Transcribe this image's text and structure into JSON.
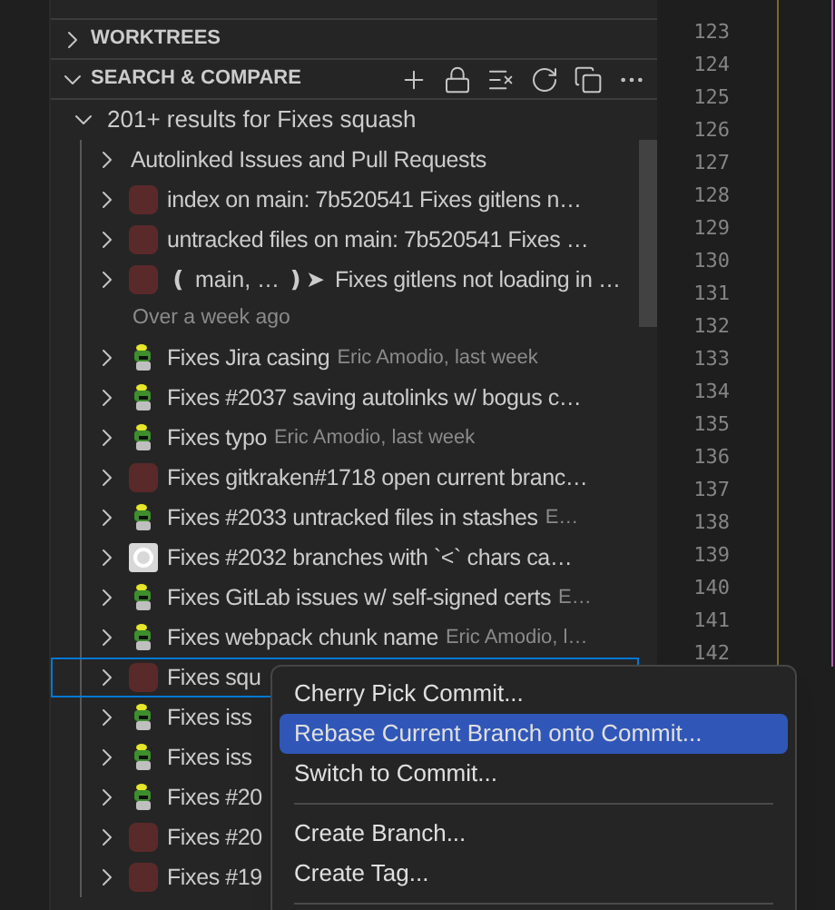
{
  "sections": [
    {
      "title": "WORKTREES",
      "expanded": false
    },
    {
      "title": "SEARCH & COMPARE",
      "expanded": true
    }
  ],
  "results": {
    "label": "201+ results for Fixes squash",
    "expanded": true,
    "rows": [
      {
        "kind": "group",
        "message": "Autolinked Issues and Pull Requests"
      },
      {
        "kind": "commit",
        "avatar": {
          "kind": "photo"
        },
        "message": "index on main: 7b520541 Fixes gitlens n…",
        "selected": false
      },
      {
        "kind": "commit",
        "avatar": {
          "kind": "photo"
        },
        "message": "untracked files on main: 7b520541 Fixes …",
        "selected": false
      },
      {
        "kind": "commit",
        "avatar": {
          "kind": "photo"
        },
        "badge": "❪ main, … ❫➤",
        "message": "Fixes gitlens not loading in …",
        "selected": false
      },
      {
        "kind": "separator",
        "message": "Over a week ago"
      },
      {
        "kind": "commit",
        "avatar": {
          "kind": "robot"
        },
        "message": "Fixes Jira casing",
        "author": "Eric Amodio, last week",
        "selected": false
      },
      {
        "kind": "commit",
        "avatar": {
          "kind": "robot"
        },
        "message": "Fixes #2037 saving autolinks w/ bogus c…",
        "selected": false
      },
      {
        "kind": "commit",
        "avatar": {
          "kind": "robot"
        },
        "message": "Fixes typo",
        "author": "Eric Amodio, last week",
        "selected": false
      },
      {
        "kind": "commit",
        "avatar": {
          "kind": "photo"
        },
        "message": "Fixes gitkraken#1718 open current branc…",
        "selected": false
      },
      {
        "kind": "commit",
        "avatar": {
          "kind": "robot"
        },
        "message": "Fixes #2033 untracked files in stashes",
        "author": "E…",
        "selected": false
      },
      {
        "kind": "commit",
        "avatar": {
          "kind": "github"
        },
        "message": "Fixes #2032 branches with `<` chars ca…",
        "selected": false
      },
      {
        "kind": "commit",
        "avatar": {
          "kind": "robot"
        },
        "message": "Fixes GitLab issues w/ self-signed certs",
        "author": "E…",
        "selected": false
      },
      {
        "kind": "commit",
        "avatar": {
          "kind": "robot"
        },
        "message": "Fixes webpack chunk name",
        "author": "Eric Amodio, l…",
        "selected": false
      },
      {
        "kind": "commit",
        "avatar": {
          "kind": "photo"
        },
        "message": "Fixes squ",
        "selected": true
      },
      {
        "kind": "commit",
        "avatar": {
          "kind": "robot"
        },
        "message": "Fixes iss",
        "selected": false
      },
      {
        "kind": "commit",
        "avatar": {
          "kind": "robot"
        },
        "message": "Fixes iss",
        "selected": false
      },
      {
        "kind": "commit",
        "avatar": {
          "kind": "robot"
        },
        "message": "Fixes #20",
        "selected": false
      },
      {
        "kind": "commit",
        "avatar": {
          "kind": "photo"
        },
        "message": "Fixes #20",
        "selected": false
      },
      {
        "kind": "commit",
        "avatar": {
          "kind": "photo"
        },
        "message": "Fixes #19",
        "selected": false
      }
    ]
  },
  "line_numbers": [
    "123",
    "124",
    "125",
    "126",
    "127",
    "128",
    "129",
    "130",
    "131",
    "132",
    "133",
    "134",
    "135",
    "136",
    "137",
    "138",
    "139",
    "140",
    "141",
    "142"
  ],
  "context_menu": [
    {
      "kind": "item",
      "label": "Cherry Pick Commit...",
      "selected": false
    },
    {
      "kind": "item",
      "label": "Rebase Current Branch onto Commit...",
      "selected": true
    },
    {
      "kind": "item",
      "label": "Switch to Commit...",
      "selected": false
    },
    {
      "kind": "separator"
    },
    {
      "kind": "item",
      "label": "Create Branch...",
      "selected": false
    },
    {
      "kind": "item",
      "label": "Create Tag...",
      "selected": false
    },
    {
      "kind": "separator"
    }
  ]
}
